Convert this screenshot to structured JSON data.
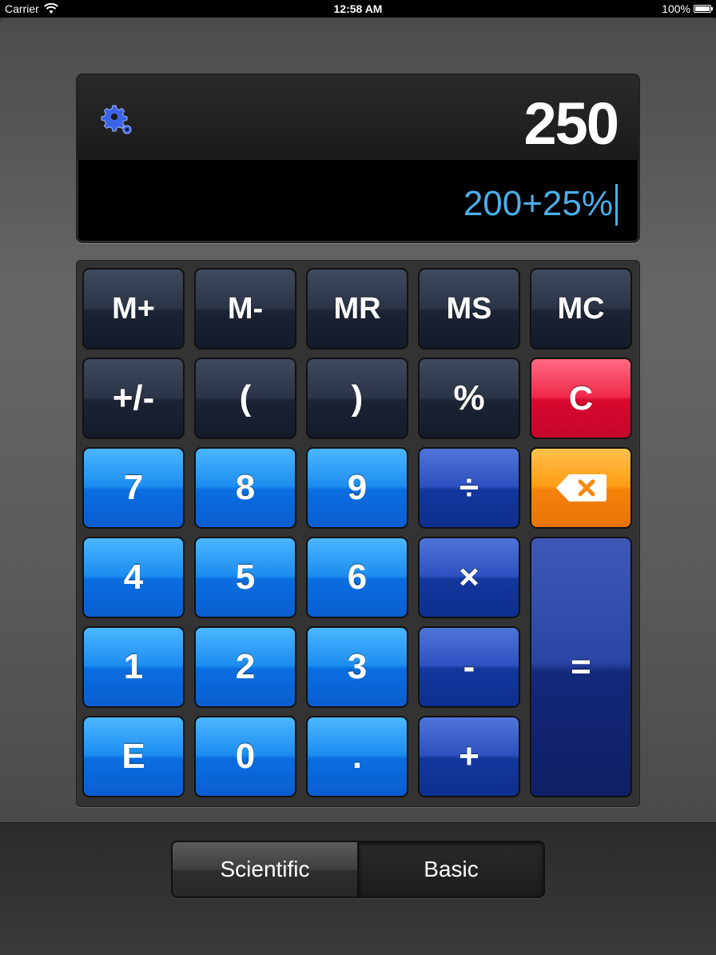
{
  "status_bar": {
    "carrier": "Carrier",
    "time": "12:58 AM",
    "battery": "100%"
  },
  "display": {
    "result": "250",
    "expression": "200+25%"
  },
  "keys": {
    "m_plus": "M+",
    "m_minus": "M-",
    "mr": "MR",
    "ms": "MS",
    "mc": "MC",
    "plus_minus": "+/-",
    "open_paren": "(",
    "close_paren": ")",
    "percent": "%",
    "clear": "C",
    "seven": "7",
    "eight": "8",
    "nine": "9",
    "divide": "÷",
    "four": "4",
    "five": "5",
    "six": "6",
    "multiply": "×",
    "one": "1",
    "two": "2",
    "three": "3",
    "minus": "-",
    "equals": "=",
    "exp": "E",
    "zero": "0",
    "dot": ".",
    "plus": "+"
  },
  "mode_selector": {
    "scientific": "Scientific",
    "basic": "Basic",
    "selected": "Basic"
  },
  "colors": {
    "expression": "#4aaeea",
    "clear_key": "#e0143a",
    "backspace_key": "#f58a0a"
  }
}
